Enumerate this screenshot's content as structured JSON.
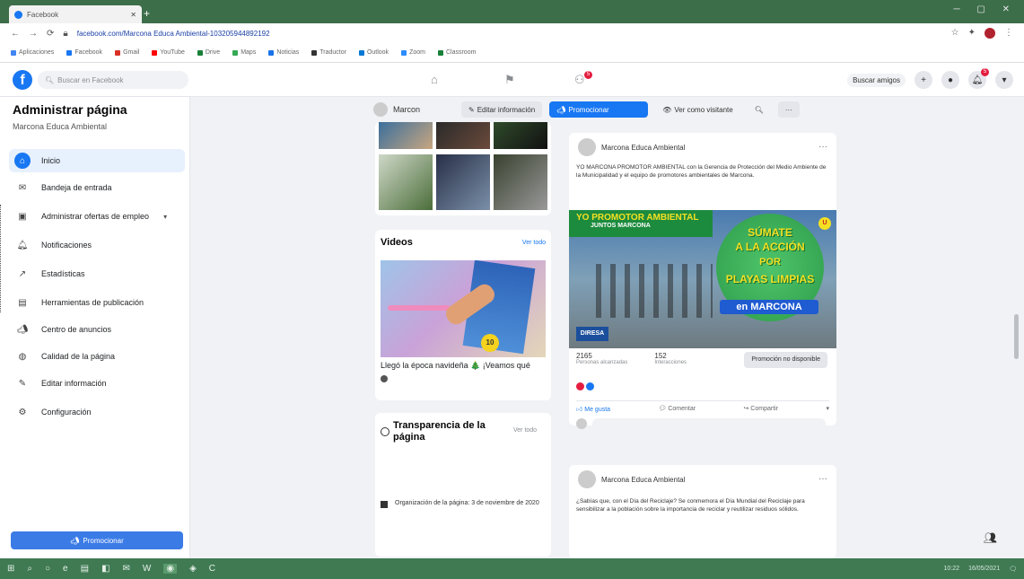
{
  "browser": {
    "tab_title": "Facebook",
    "new_tab_icon": "+",
    "url": "facebook.com/Marcona Educa Ambiental-103205944892192"
  },
  "bookmarks": [
    {
      "label": "Aplicaciones",
      "color": "#4285f4"
    },
    {
      "label": "Facebook",
      "color": "#1877f2"
    },
    {
      "label": "Gmail",
      "color": "#d93025"
    },
    {
      "label": "YouTube",
      "color": "#ff0000"
    },
    {
      "label": "Drive",
      "color": "#188038"
    },
    {
      "label": "Maps",
      "color": "#34a853"
    },
    {
      "label": "Noticias",
      "color": "#1a73e8"
    },
    {
      "label": "Traductor",
      "color": "#333333"
    },
    {
      "label": "Outlook",
      "color": "#0078d4"
    },
    {
      "label": "Zoom",
      "color": "#2d8cff"
    },
    {
      "label": "Classroom",
      "color": "#188038"
    }
  ],
  "fb_header": {
    "search_placeholder": "Buscar en Facebook",
    "notification_count": "5",
    "user_label": "Buscar amigos"
  },
  "sidebar": {
    "title": "Administrar página",
    "subtitle": "Marcona Educa Ambiental",
    "items": [
      {
        "label": "Inicio",
        "note": "",
        "icon": "home-icon"
      },
      {
        "label": "Bandeja de entrada",
        "note": "",
        "icon": "inbox-icon"
      },
      {
        "label": "Administrar ofertas de empleo",
        "note": "",
        "icon": "briefcase-icon"
      },
      {
        "label": "Notificaciones",
        "note": "",
        "icon": "bell-icon"
      },
      {
        "label": "Estadísticas",
        "note": "",
        "icon": "chart-icon"
      },
      {
        "label": "Herramientas de publicación",
        "note": "",
        "icon": "publish-icon"
      },
      {
        "label": "Centro de anuncios",
        "note": "",
        "icon": "megaphone-icon"
      },
      {
        "label": "Calidad de la página",
        "note": "",
        "icon": "shield-icon"
      },
      {
        "label": "Editar información",
        "note": "",
        "icon": "pencil-icon"
      },
      {
        "label": "Configuración",
        "note": "",
        "icon": "gear-icon"
      }
    ],
    "promote_label": "Promocionar"
  },
  "page_bar": {
    "page_name": "Marcon",
    "edit_label": "Editar información",
    "promote_label": "Promocionar",
    "view_as_label": "Ver como visitante"
  },
  "videos": {
    "heading": "Videos",
    "see_all": "Ver todo",
    "caption": "Llegó la época navideña 🎄 ¡Veamos qué",
    "thumb_sticker": "10"
  },
  "transparency": {
    "heading": "Transparencia de la página",
    "see_all": "Ver todo",
    "flag_text": "Organización de la página: 3 de noviembre de 2020"
  },
  "post1": {
    "author": "Marcona Educa Ambiental",
    "text": "YO MARCONA PROMOTOR AMBIENTAL con la Gerencia de Protección del Medio Ambiente de la Municipalidad y el equipo de promotores ambientales de Marcona.",
    "image": {
      "line1": "YO PROMOTOR AMBIENTAL",
      "line2": "JUNTOS MARCONA",
      "big1": "SÚMATE",
      "big2": "A LA ACCIÓN",
      "big3": "POR",
      "big4": "PLAYAS LIMPIAS",
      "banner": "en MARCONA",
      "logo": "DIRESA",
      "badge": "U"
    },
    "reach_value": "2165",
    "reach_label": "Personas alcanzadas",
    "engage_value": "152",
    "engage_label": "Interacciones",
    "boost_label": "Promoción no disponible",
    "like_label": "Me gusta",
    "comment_label": "Comentar",
    "share_label": "Compartir"
  },
  "post2": {
    "author": "Marcona Educa Ambiental",
    "text": "¿Sabías que, con el Día del Reciclaje? Se conmemora el Día Mundial del Reciclaje para sensibilizar a la población sobre la importancia de reciclar y reutilizar residuos sólidos."
  },
  "taskbar": {
    "time": "10:22",
    "date": "16/05/2021"
  }
}
